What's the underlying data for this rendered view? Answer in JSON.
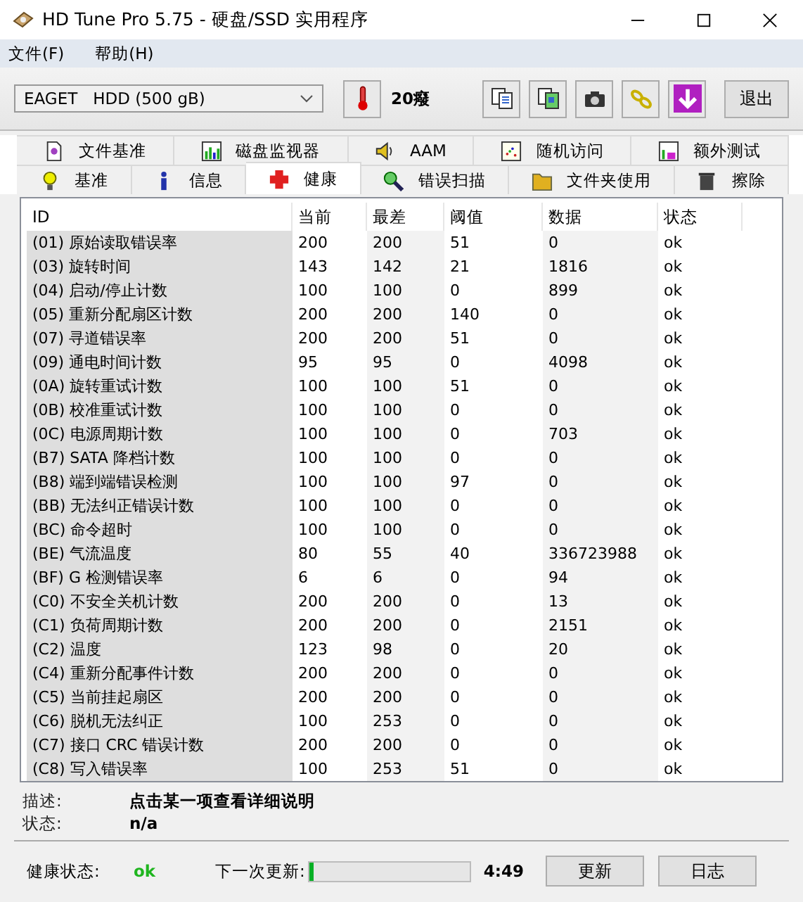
{
  "window": {
    "title": "HD Tune Pro 5.75 - 硬盘/SSD 实用程序"
  },
  "menu": [
    "文件(F)",
    "帮助(H)"
  ],
  "toolbar": {
    "drive": "EAGET   HDD (500 gB)",
    "temperature": "20癈",
    "exit": "退出"
  },
  "tab_rows": [
    [
      {
        "label": "文件基准",
        "selected": false
      },
      {
        "label": "磁盘监视器",
        "selected": false
      },
      {
        "label": "AAM",
        "selected": false
      },
      {
        "label": "随机访问",
        "selected": false
      },
      {
        "label": "额外测试",
        "selected": false
      }
    ],
    [
      {
        "label": "基准",
        "selected": false
      },
      {
        "label": "信息",
        "selected": false
      },
      {
        "label": "健康",
        "selected": true
      },
      {
        "label": "错误扫描",
        "selected": false
      },
      {
        "label": "文件夹使用",
        "selected": false
      },
      {
        "label": "擦除",
        "selected": false
      }
    ]
  ],
  "table": {
    "columns": [
      "ID",
      "当前",
      "最差",
      "阈值",
      "数据",
      "状态"
    ],
    "rows": [
      [
        "(01) 原始读取错误率",
        "200",
        "200",
        "51",
        "0",
        "ok"
      ],
      [
        "(03) 旋转时间",
        "143",
        "142",
        "21",
        "1816",
        "ok"
      ],
      [
        "(04) 启动/停止计数",
        "100",
        "100",
        "0",
        "899",
        "ok"
      ],
      [
        "(05) 重新分配扇区计数",
        "200",
        "200",
        "140",
        "0",
        "ok"
      ],
      [
        "(07) 寻道错误率",
        "200",
        "200",
        "51",
        "0",
        "ok"
      ],
      [
        "(09) 通电时间计数",
        "95",
        "95",
        "0",
        "4098",
        "ok"
      ],
      [
        "(0A) 旋转重试计数",
        "100",
        "100",
        "51",
        "0",
        "ok"
      ],
      [
        "(0B) 校准重试计数",
        "100",
        "100",
        "0",
        "0",
        "ok"
      ],
      [
        "(0C) 电源周期计数",
        "100",
        "100",
        "0",
        "703",
        "ok"
      ],
      [
        "(B7) SATA 降档计数",
        "100",
        "100",
        "0",
        "0",
        "ok"
      ],
      [
        "(B8) 端到端错误检测",
        "100",
        "100",
        "97",
        "0",
        "ok"
      ],
      [
        "(BB) 无法纠正错误计数",
        "100",
        "100",
        "0",
        "0",
        "ok"
      ],
      [
        "(BC) 命令超时",
        "100",
        "100",
        "0",
        "0",
        "ok"
      ],
      [
        "(BE) 气流温度",
        "80",
        "55",
        "40",
        "336723988",
        "ok"
      ],
      [
        "(BF) G 检测错误率",
        "6",
        "6",
        "0",
        "94",
        "ok"
      ],
      [
        "(C0) 不安全关机计数",
        "200",
        "200",
        "0",
        "13",
        "ok"
      ],
      [
        "(C1) 负荷周期计数",
        "200",
        "200",
        "0",
        "2151",
        "ok"
      ],
      [
        "(C2) 温度",
        "123",
        "98",
        "0",
        "20",
        "ok"
      ],
      [
        "(C4) 重新分配事件计数",
        "200",
        "200",
        "0",
        "0",
        "ok"
      ],
      [
        "(C5) 当前挂起扇区",
        "200",
        "200",
        "0",
        "0",
        "ok"
      ],
      [
        "(C6) 脱机无法纠正",
        "100",
        "253",
        "0",
        "0",
        "ok"
      ],
      [
        "(C7) 接口 CRC 错误计数",
        "200",
        "200",
        "0",
        "0",
        "ok"
      ],
      [
        "(C8) 写入错误率",
        "100",
        "253",
        "51",
        "0",
        "ok"
      ]
    ]
  },
  "details": [
    {
      "label": "描述:",
      "value": "点击某一项查看详细说明"
    },
    {
      "label": "状态:",
      "value": "n/a"
    }
  ],
  "footer": {
    "health_label": "健康状态:",
    "health": "ok",
    "next_label": "下一次更新:",
    "level": 0.03,
    "time": "4:49",
    "buttons": [
      "更新",
      "日志"
    ]
  }
}
